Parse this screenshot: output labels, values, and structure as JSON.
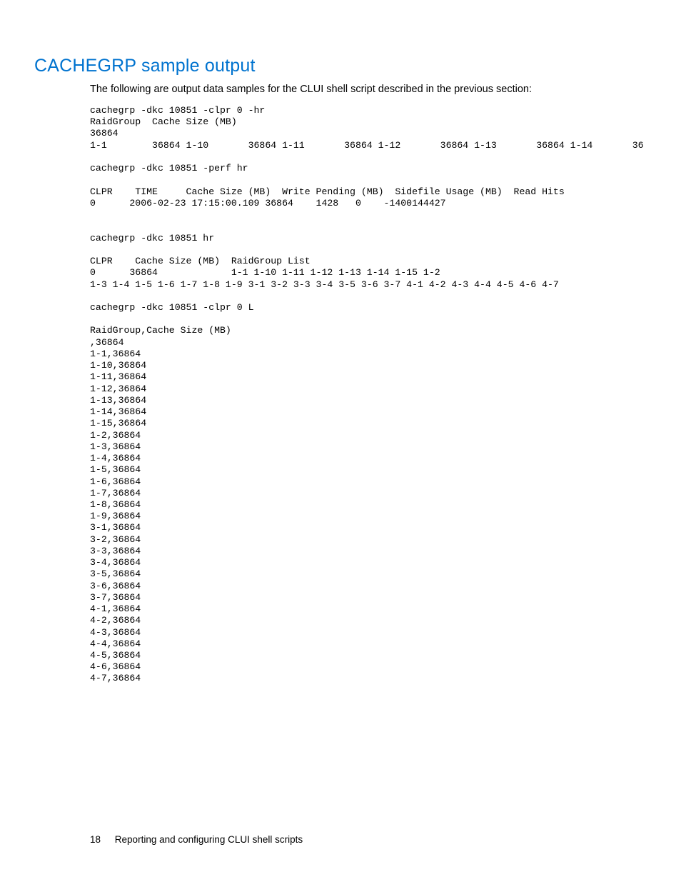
{
  "heading": "CACHEGRP sample output",
  "intro": "The following are output data samples for the CLUI shell script described in the previous section:",
  "code": "cachegrp -dkc 10851 -clpr 0 -hr\nRaidGroup  Cache Size (MB)\n36864\n1-1        36864 1-10       36864 1-11       36864 1-12       36864 1-13       36864 1-14       36\n\ncachegrp -dkc 10851 -perf hr\n\nCLPR    TIME     Cache Size (MB)  Write Pending (MB)  Sidefile Usage (MB)  Read Hits\n0      2006-02-23 17:15:00.109 36864    1428   0    -1400144427\n\n\ncachegrp -dkc 10851 hr\n\nCLPR    Cache Size (MB)  RaidGroup List\n0      36864             1-1 1-10 1-11 1-12 1-13 1-14 1-15 1-2\n1-3 1-4 1-5 1-6 1-7 1-8 1-9 3-1 3-2 3-3 3-4 3-5 3-6 3-7 4-1 4-2 4-3 4-4 4-5 4-6 4-7\n\ncachegrp -dkc 10851 -clpr 0 L\n\nRaidGroup,Cache Size (MB)\n,36864\n1-1,36864\n1-10,36864\n1-11,36864\n1-12,36864\n1-13,36864\n1-14,36864\n1-15,36864\n1-2,36864\n1-3,36864\n1-4,36864\n1-5,36864\n1-6,36864\n1-7,36864\n1-8,36864\n1-9,36864\n3-1,36864\n3-2,36864\n3-3,36864\n3-4,36864\n3-5,36864\n3-6,36864\n3-7,36864\n4-1,36864\n4-2,36864\n4-3,36864\n4-4,36864\n4-5,36864\n4-6,36864\n4-7,36864",
  "footer": {
    "page_number": "18",
    "section_title": "Reporting and configuring CLUI shell scripts"
  }
}
